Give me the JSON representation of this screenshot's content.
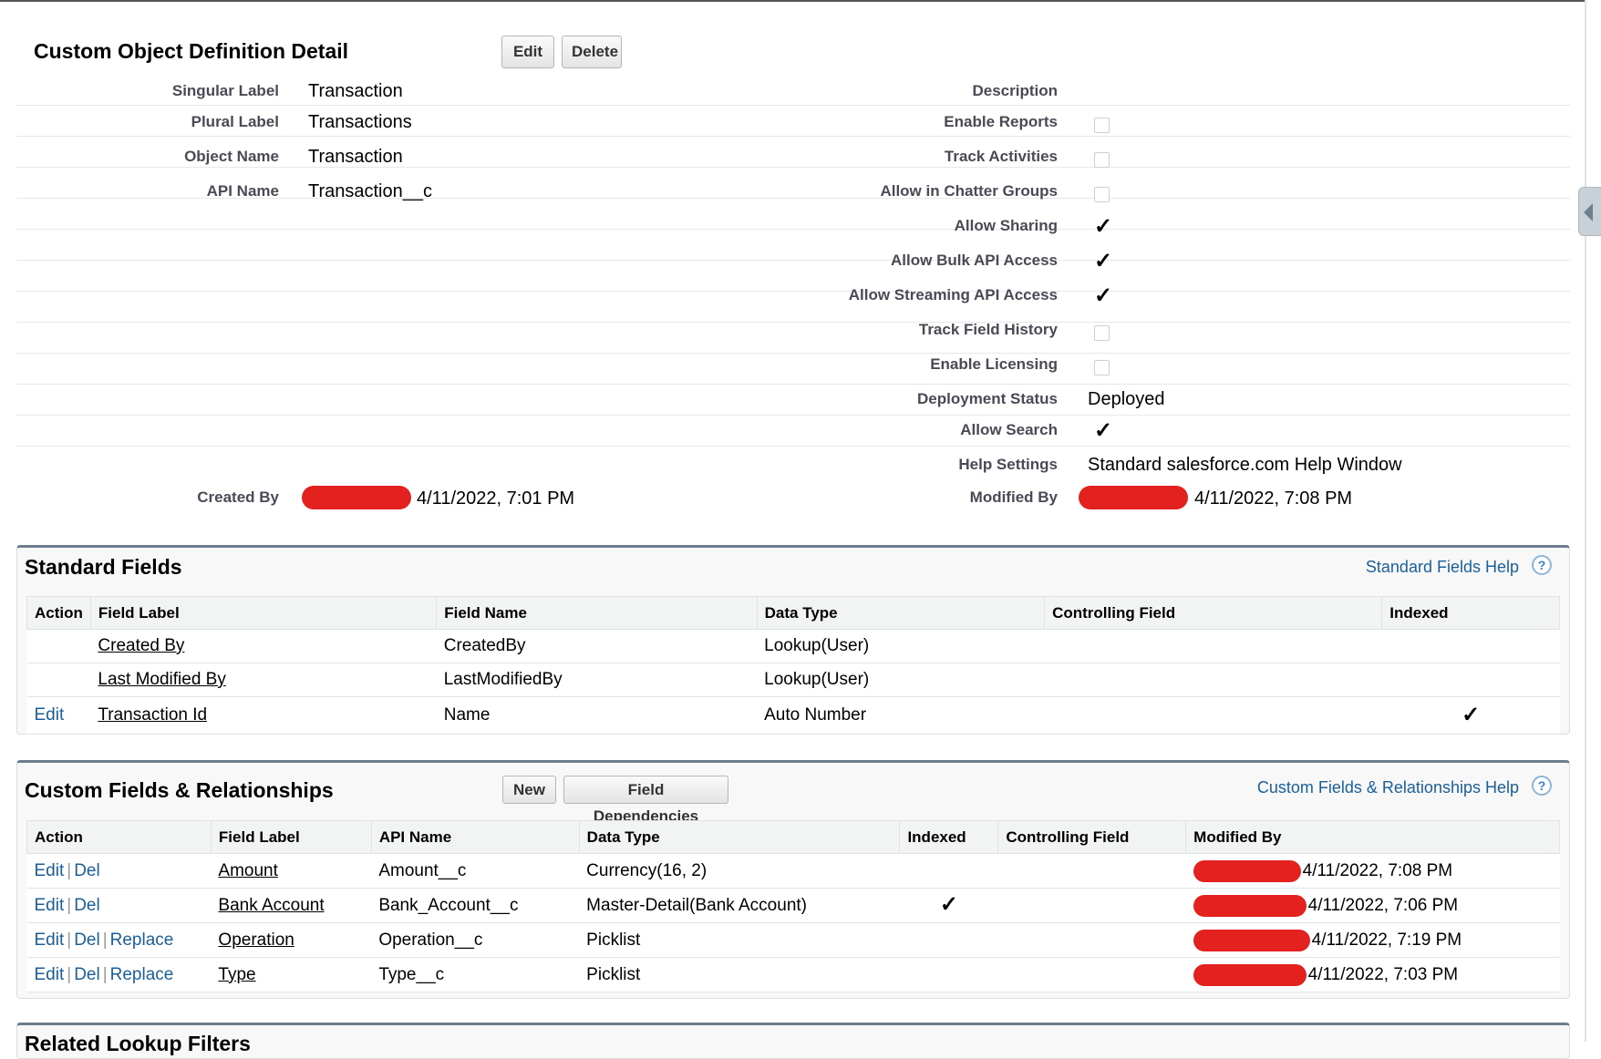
{
  "header": {
    "title": "Custom Object Definition Detail",
    "edit_label": "Edit",
    "delete_label": "Delete"
  },
  "detail": {
    "left": [
      {
        "label": "Singular Label",
        "value": "Transaction"
      },
      {
        "label": "Plural Label",
        "value": "Transactions"
      },
      {
        "label": "Object Name",
        "value": "Transaction"
      },
      {
        "label": "API Name",
        "value": "Transaction__c"
      }
    ],
    "right": [
      {
        "label": "Description",
        "value": ""
      },
      {
        "label": "Enable Reports",
        "checked": false
      },
      {
        "label": "Track Activities",
        "checked": false
      },
      {
        "label": "Allow in Chatter Groups",
        "checked": false
      },
      {
        "label": "Allow Sharing",
        "checked": true
      },
      {
        "label": "Allow Bulk API Access",
        "checked": true
      },
      {
        "label": "Allow Streaming API Access",
        "checked": true
      },
      {
        "label": "Track Field History",
        "checked": false
      },
      {
        "label": "Enable Licensing",
        "checked": false
      },
      {
        "label": "Deployment Status",
        "value": "Deployed"
      },
      {
        "label": "Allow Search",
        "checked": true
      },
      {
        "label": "Help Settings",
        "value": "Standard salesforce.com Help Window"
      }
    ],
    "created_by": {
      "label": "Created By",
      "timestamp": "4/11/2022, 7:01 PM"
    },
    "modified_by": {
      "label": "Modified By",
      "timestamp": "4/11/2022, 7:08 PM"
    },
    "checkmark": "✓",
    "redaction_color": "#e3211f"
  },
  "standard_fields": {
    "title": "Standard Fields",
    "help": "Standard Fields Help",
    "help_icon": "?",
    "columns": [
      "Action",
      "Field Label",
      "Field Name",
      "Data Type",
      "Controlling Field",
      "Indexed"
    ],
    "rows": [
      {
        "action": "",
        "label": "Created By",
        "name": "CreatedBy",
        "type": "Lookup(User)",
        "controlling": "",
        "indexed": false
      },
      {
        "action": "",
        "label": "Last Modified By",
        "name": "LastModifiedBy",
        "type": "Lookup(User)",
        "controlling": "",
        "indexed": false
      },
      {
        "action": "Edit",
        "label": "Transaction Id",
        "name": "Name",
        "type": "Auto Number",
        "controlling": "",
        "indexed": true
      }
    ]
  },
  "custom_fields": {
    "title": "Custom Fields & Relationships",
    "new_label": "New",
    "deps_label": "Field Dependencies",
    "help": "Custom Fields & Relationships Help",
    "help_icon": "?",
    "columns": [
      "Action",
      "Field Label",
      "API Name",
      "Data Type",
      "Indexed",
      "Controlling Field",
      "Modified By"
    ],
    "action_labels": {
      "edit": "Edit",
      "del": "Del",
      "replace": "Replace",
      "sep": "|"
    },
    "rows": [
      {
        "actions": [
          "edit",
          "del"
        ],
        "label": "Amount",
        "api": "Amount__c",
        "type": "Currency(16, 2)",
        "indexed": false,
        "controlling": "",
        "modified": "4/11/2022, 7:08 PM"
      },
      {
        "actions": [
          "edit",
          "del"
        ],
        "label": "Bank Account",
        "api": "Bank_Account__c",
        "type": "Master-Detail(Bank Account)",
        "indexed": true,
        "controlling": "",
        "modified": "4/11/2022, 7:06 PM"
      },
      {
        "actions": [
          "edit",
          "del",
          "replace"
        ],
        "label": "Operation",
        "api": "Operation__c",
        "type": "Picklist",
        "indexed": false,
        "controlling": "",
        "modified": "4/11/2022, 7:19 PM"
      },
      {
        "actions": [
          "edit",
          "del",
          "replace"
        ],
        "label": "Type",
        "api": "Type__c",
        "type": "Picklist",
        "indexed": false,
        "controlling": "",
        "modified": "4/11/2022, 7:03 PM"
      }
    ]
  },
  "related_lookup": {
    "title": "Related Lookup Filters"
  }
}
